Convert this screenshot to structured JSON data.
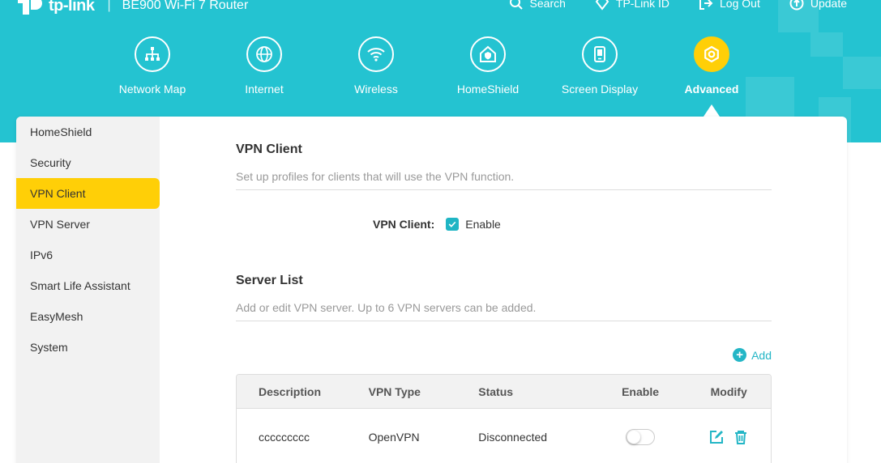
{
  "header": {
    "brand": "tp-link",
    "separator": "|",
    "model": "BE900 Wi-Fi 7 Router",
    "links": [
      {
        "label": "Search",
        "icon": "search-icon"
      },
      {
        "label": "TP-Link ID",
        "icon": "tplink-id-icon"
      },
      {
        "label": "Log Out",
        "icon": "logout-icon"
      },
      {
        "label": "Update",
        "icon": "update-icon"
      }
    ]
  },
  "nav": {
    "items": [
      {
        "label": "Network Map",
        "icon": "network-map-icon"
      },
      {
        "label": "Internet",
        "icon": "globe-icon"
      },
      {
        "label": "Wireless",
        "icon": "wifi-icon"
      },
      {
        "label": "HomeShield",
        "icon": "homeshield-icon"
      },
      {
        "label": "Screen Display",
        "icon": "screen-display-icon"
      },
      {
        "label": "Advanced",
        "icon": "gear-icon",
        "active": true
      }
    ]
  },
  "sidebar": {
    "items": [
      {
        "label": "HomeShield"
      },
      {
        "label": "Security"
      },
      {
        "label": "VPN Client",
        "active": true
      },
      {
        "label": "VPN Server"
      },
      {
        "label": "IPv6"
      },
      {
        "label": "Smart Life Assistant"
      },
      {
        "label": "EasyMesh"
      },
      {
        "label": "System"
      }
    ]
  },
  "vpn_client": {
    "title": "VPN Client",
    "description": "Set up profiles for clients that will use the VPN function.",
    "field_label": "VPN Client",
    "field_colon": ":",
    "enable_label": "Enable",
    "enabled": true
  },
  "server_list": {
    "title": "Server List",
    "description": "Add or edit VPN server. Up to 6 VPN servers can be added.",
    "add_label": "Add",
    "columns": [
      "Description",
      "VPN Type",
      "Status",
      "Enable",
      "Modify"
    ],
    "rows": [
      {
        "description": "ccccccccc",
        "vpn_type": "OpenVPN",
        "status": "Disconnected",
        "enabled": false
      }
    ]
  },
  "colors": {
    "header_bg": "#24c3d1",
    "accent_yellow": "#ffcf07",
    "accent_teal": "#24b6c6",
    "sidebar_bg": "#f2f2f2"
  }
}
